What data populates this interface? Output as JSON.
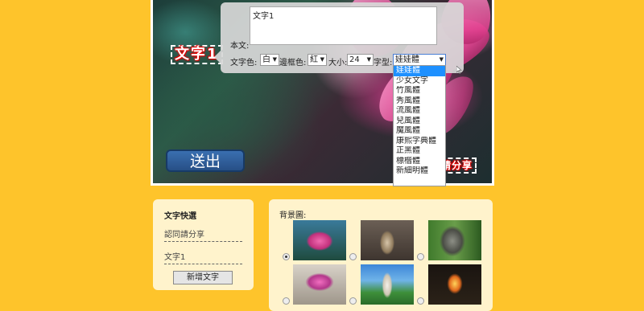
{
  "canvas": {
    "text_item_1": "文字1",
    "text_item_2": "認同請分享"
  },
  "submit_label": "送出",
  "editor": {
    "body_label": "本文:",
    "body_value": "文字1",
    "text_color_label": "文字色:",
    "text_color_value": "白",
    "border_color_label": "邊框色:",
    "border_color_value": "紅",
    "size_label": "大小:",
    "size_value": "24",
    "font_label": "字型:",
    "font_value": "娃娃體"
  },
  "font_options": [
    "娃娃體",
    "少女文字",
    "竹風體",
    "秀風體",
    "流風體",
    "兒風體",
    "魔風體",
    "康熙字典體",
    "正黑體",
    "標楷體",
    "新細明體"
  ],
  "quick_panel": {
    "title": "文字快選",
    "items": [
      "認同請分享",
      "文字1"
    ],
    "add_button": "新增文字"
  },
  "bg_panel": {
    "title": "背景圖:",
    "thumbnails": [
      "lotus",
      "buddha-statue",
      "stone-buddha-face",
      "pink-flower-bowl",
      "guanyin-statue",
      "fire-buddha"
    ],
    "selected_index": 0
  },
  "colors": {
    "background": "#fec42b",
    "panel": "#fff3cc",
    "button": "#2f5f9e",
    "accent": "#1e90ff"
  }
}
